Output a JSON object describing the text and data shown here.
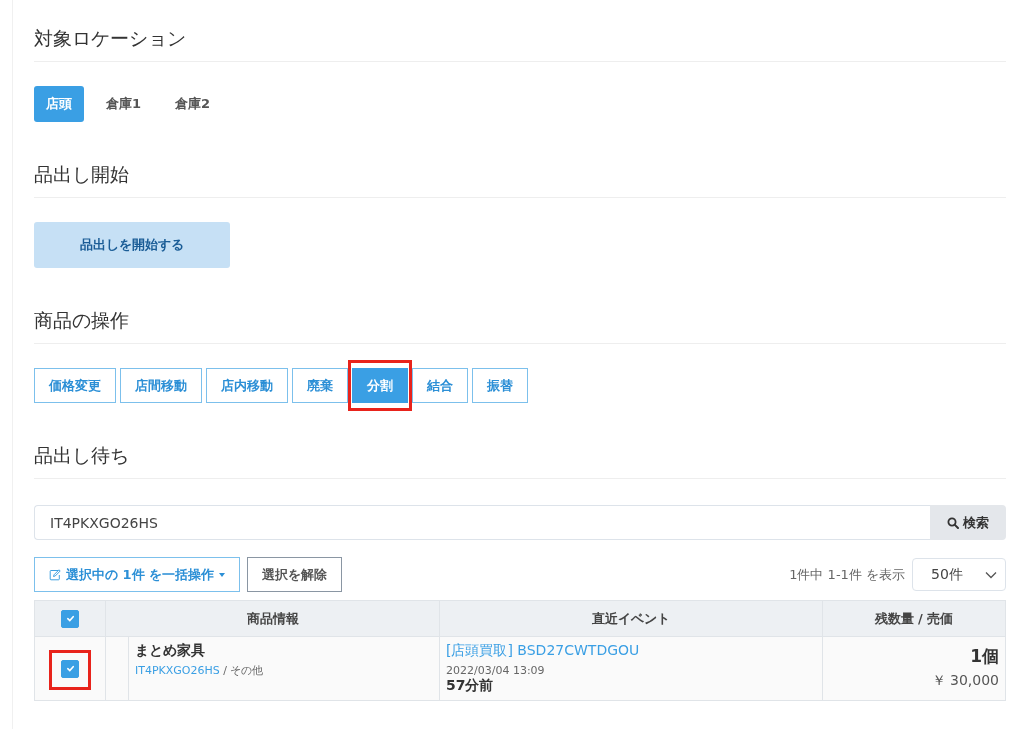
{
  "sections": [
    {
      "kind": "tabs",
      "title": "対象ロケーション",
      "items": [
        {
          "label": "店頭",
          "selected": true
        },
        {
          "label": "倉庫1",
          "selected": false
        },
        {
          "label": "倉庫2",
          "selected": false
        }
      ]
    },
    {
      "kind": "start",
      "title": "品出し開始",
      "button": "品出しを開始する"
    },
    {
      "kind": "operations",
      "title": "商品の操作",
      "items": [
        {
          "label": "価格変更",
          "selected": false,
          "highlighted": false
        },
        {
          "label": "店間移動",
          "selected": false,
          "highlighted": false
        },
        {
          "label": "店内移動",
          "selected": false,
          "highlighted": false
        },
        {
          "label": "廃棄",
          "selected": false,
          "highlighted": false
        },
        {
          "label": "分割",
          "selected": true,
          "highlighted": true
        },
        {
          "label": "結合",
          "selected": false,
          "highlighted": false
        },
        {
          "label": "振替",
          "selected": false,
          "highlighted": false
        }
      ]
    },
    {
      "kind": "list",
      "title": "品出し待ち"
    }
  ],
  "search": {
    "value": "IT4PKXGO26HS",
    "button": "検索"
  },
  "bulk": {
    "label": "選択中の 1件 を一括操作",
    "clear": "選択を解除",
    "summary": "1件中 1-1件 を表示",
    "per_page": "50件"
  },
  "table": {
    "select_all_checked": true,
    "columns": [
      "商品情報",
      "直近イベント",
      "残数量 / 売価"
    ],
    "rows": [
      {
        "checked": true,
        "highlighted": true,
        "name": "まとめ家具",
        "code": "IT4PKXGO26HS",
        "category": " / その他",
        "event": "[店頭買取] BSD27CWTDGOU",
        "date": "2022/03/04 13:09",
        "ago": "57分前",
        "quantity": "1個",
        "price": "￥ 30,000"
      }
    ]
  }
}
